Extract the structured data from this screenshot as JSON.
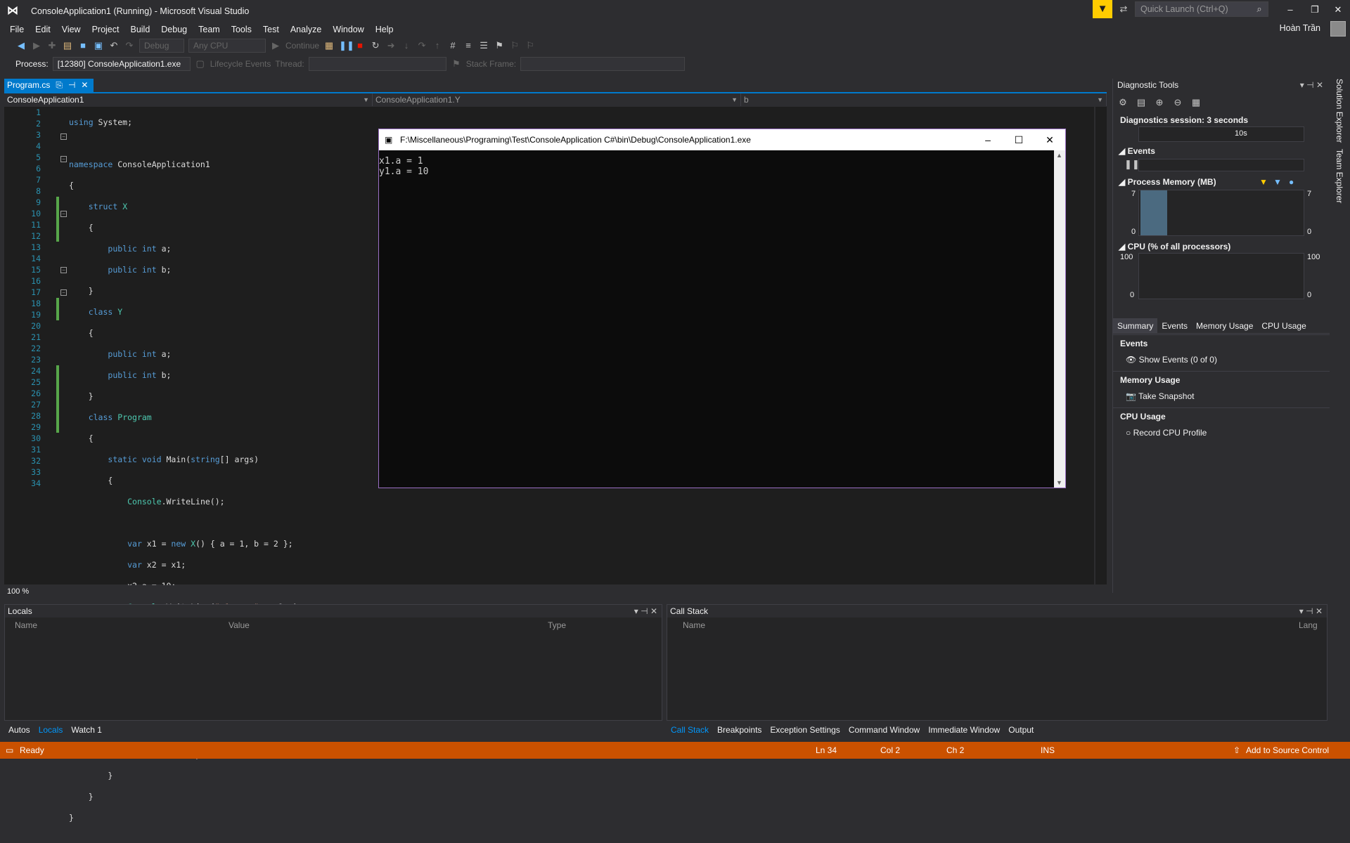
{
  "window": {
    "title": "ConsoleApplication1 (Running) - Microsoft Visual Studio",
    "quick_launch_placeholder": "Quick Launch (Ctrl+Q)",
    "user": "Hoàn Trần"
  },
  "menu": [
    "File",
    "Edit",
    "View",
    "Project",
    "Build",
    "Debug",
    "Team",
    "Tools",
    "Test",
    "Analyze",
    "Window",
    "Help"
  ],
  "toolbar": {
    "config": "Debug",
    "platform": "Any CPU",
    "continue_label": "Continue",
    "process_label": "Process:",
    "process_value": "[12380] ConsoleApplication1.exe",
    "lifecycle_label": "Lifecycle Events",
    "thread_label": "Thread:",
    "stackframe_label": "Stack Frame:"
  },
  "tabs": [
    {
      "label": "Program.cs"
    }
  ],
  "navbar": {
    "project": "ConsoleApplication1",
    "type": "ConsoleApplication1.Y",
    "member": "b"
  },
  "editor": {
    "zoom": "100 %",
    "line_numbers": [
      "1",
      "2",
      "3",
      "4",
      "5",
      "6",
      "7",
      "8",
      "9",
      "10",
      "11",
      "12",
      "13",
      "14",
      "15",
      "16",
      "17",
      "18",
      "19",
      "20",
      "21",
      "22",
      "23",
      "24",
      "25",
      "26",
      "27",
      "28",
      "29",
      "30",
      "31",
      "32",
      "33",
      "34"
    ]
  },
  "console": {
    "title": "F:\\Miscellaneous\\Programing\\Test\\ConsoleApplication C#\\bin\\Debug\\ConsoleApplication1.exe",
    "output": "x1.a = 1\ny1.a = 10"
  },
  "diagnostics": {
    "title": "Diagnostic Tools",
    "session": "Diagnostics session: 3 seconds",
    "timeline_label": "10s",
    "events_section": "Events",
    "memory_section": "Process Memory (MB)",
    "memory_max": "7",
    "memory_min": "0",
    "cpu_section": "CPU (% of all processors)",
    "cpu_max": "100",
    "cpu_min": "0",
    "tabs": [
      "Summary",
      "Events",
      "Memory Usage",
      "CPU Usage"
    ],
    "events_heading": "Events",
    "show_events": "Show Events (0 of 0)",
    "memory_heading": "Memory Usage",
    "take_snapshot": "Take Snapshot",
    "cpu_heading": "CPU Usage",
    "record_cpu": "Record CPU Profile"
  },
  "side_tabs": [
    "Solution Explorer",
    "Team Explorer"
  ],
  "locals": {
    "title": "Locals",
    "columns": [
      "Name",
      "Value",
      "Type"
    ],
    "tabs": [
      "Autos",
      "Locals",
      "Watch 1"
    ]
  },
  "callstack": {
    "title": "Call Stack",
    "columns": [
      "Name",
      "Lang"
    ],
    "tabs": [
      "Call Stack",
      "Breakpoints",
      "Exception Settings",
      "Command Window",
      "Immediate Window",
      "Output"
    ]
  },
  "status": {
    "ready": "Ready",
    "ln": "Ln 34",
    "col": "Col 2",
    "ch": "Ch 2",
    "ins": "INS",
    "source_control": "Add to Source Control"
  },
  "colors": {
    "accent": "#007acc",
    "status_bar": "#ca5100",
    "editor_bg": "#1e1e1e",
    "keyword": "#569cd6",
    "type": "#4ec9b0",
    "string": "#d69d85",
    "memory_bar": "#4b6a80"
  }
}
